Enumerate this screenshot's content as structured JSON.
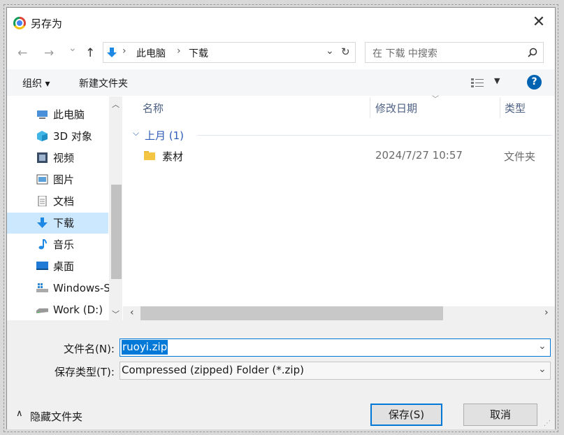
{
  "window": {
    "title": "另存为",
    "close_glyph": "✕"
  },
  "nav": {
    "back": "←",
    "forward": "→",
    "recent": "⌄",
    "up": "↑",
    "breadcrumb": [
      "此电脑",
      "下载"
    ],
    "refresh": "↻",
    "search_placeholder": "在 下载 中搜索"
  },
  "toolbar": {
    "organize": "组织 ▾",
    "new_folder": "新建文件夹",
    "help": "?"
  },
  "sidebar": {
    "items": [
      {
        "label": "此电脑",
        "icon": "computer-icon"
      },
      {
        "label": "3D 对象",
        "icon": "3d-objects-icon"
      },
      {
        "label": "视频",
        "icon": "video-icon"
      },
      {
        "label": "图片",
        "icon": "picture-icon"
      },
      {
        "label": "文档",
        "icon": "document-icon"
      },
      {
        "label": "下载",
        "icon": "download-icon",
        "selected": true
      },
      {
        "label": "音乐",
        "icon": "music-icon"
      },
      {
        "label": "桌面",
        "icon": "desktop-icon"
      },
      {
        "label": "Windows-S",
        "icon": "windows-drive-icon"
      },
      {
        "label": "Work (D:)",
        "icon": "drive-icon"
      }
    ]
  },
  "filelist": {
    "columns": [
      "名称",
      "修改日期",
      "类型"
    ],
    "group": "上月 (1)",
    "rows": [
      {
        "name": "素材",
        "date": "2024/7/27 10:57",
        "type": "文件夹"
      }
    ]
  },
  "save": {
    "filename_label": "文件名(N):",
    "filename_value": "ruoyi.zip",
    "type_label": "保存类型(T):",
    "type_value": "Compressed (zipped) Folder (*.zip)",
    "hide_folders": "隐藏文件夹",
    "save_button": "保存(S)",
    "cancel_button": "取消"
  },
  "colors": {
    "accent": "#0078d7",
    "selected": "#cce8ff",
    "header_text": "#4d6083"
  }
}
